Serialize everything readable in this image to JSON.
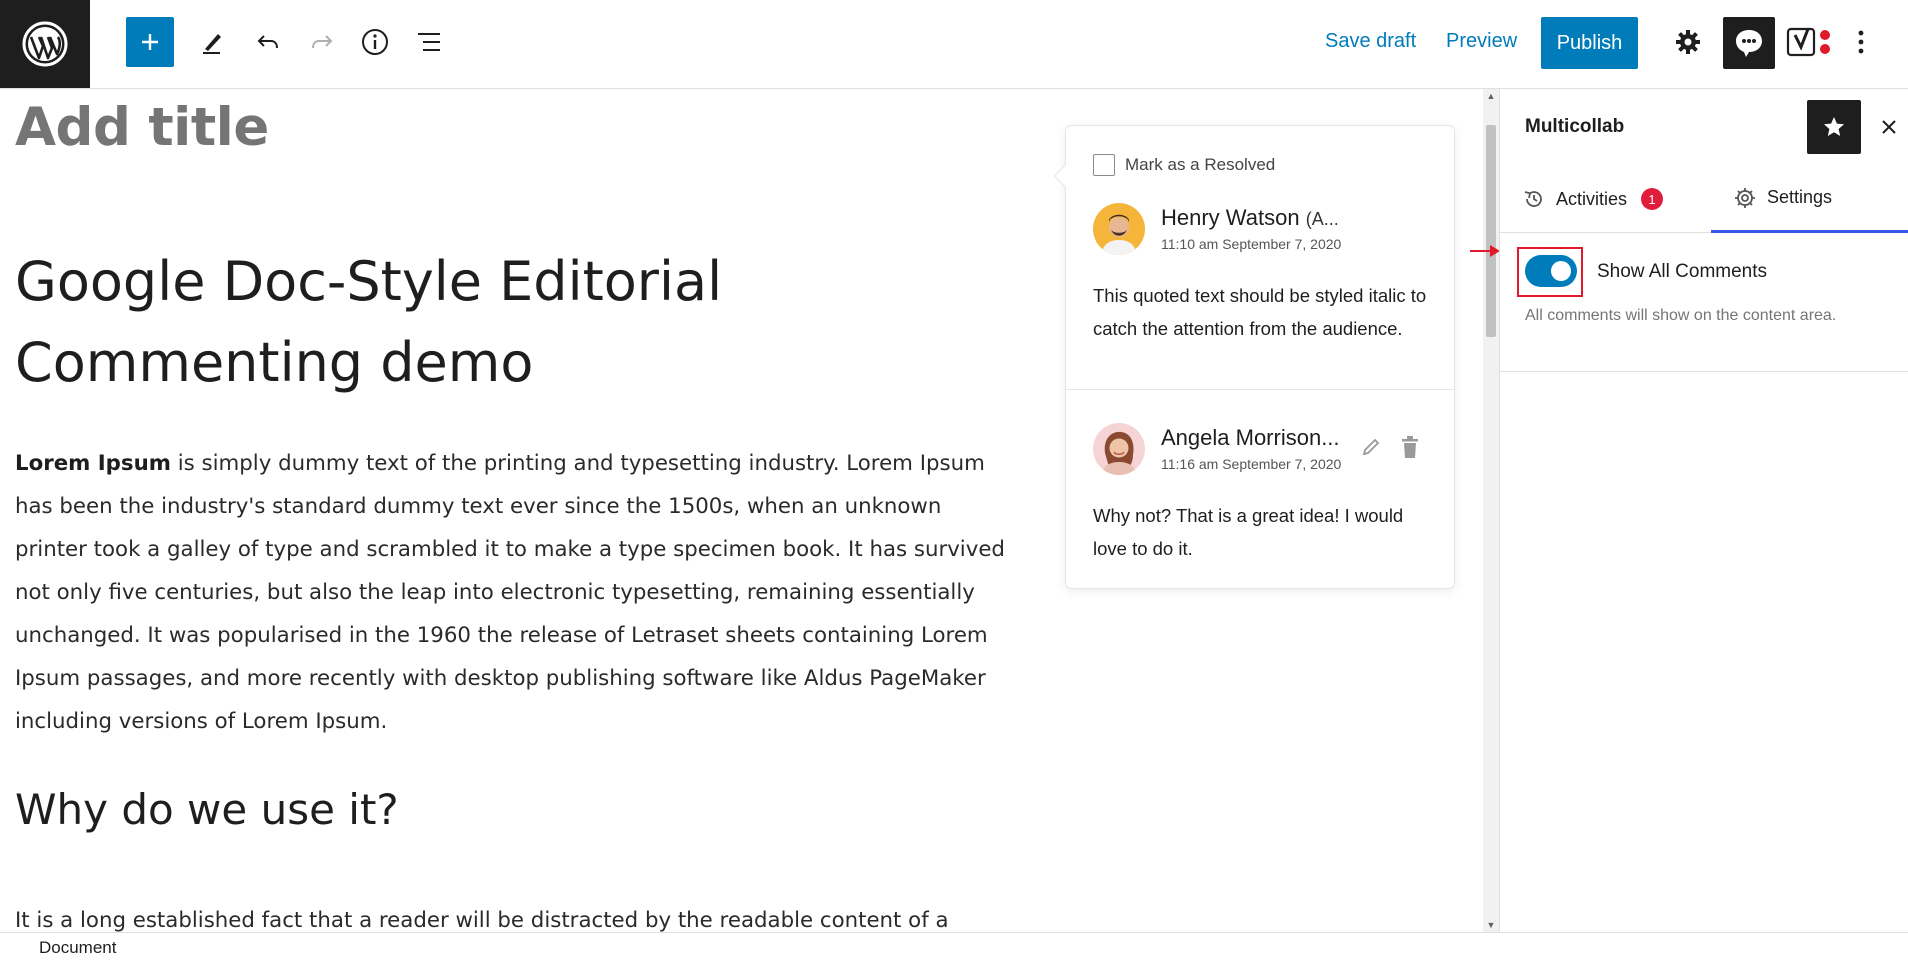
{
  "toolbar": {
    "add_block_icon": "plus-icon",
    "tools_icon": "pencil-icon",
    "undo_icon": "undo-icon",
    "redo_icon": "redo-icon",
    "details_icon": "info-icon",
    "list_view_icon": "list-view-icon",
    "save_draft_label": "Save draft",
    "preview_label": "Preview",
    "publish_label": "Publish",
    "settings_icon": "gear-icon",
    "multicollab_icon": "comment-bubble-icon",
    "yoast_icon": "yoast-icon",
    "more_icon": "kebab-menu-icon"
  },
  "editor": {
    "title_placeholder": "Add title",
    "heading": "Google Doc-Style Editorial Commenting demo",
    "paragraph_bold": "Lorem Ipsum",
    "paragraph_rest": " is simply dummy text of the printing and typesetting industry. Lorem Ipsum has been the industry's standard dummy text ever since the 1500s, when an unknown printer took a galley of type and scrambled it to make a type specimen book. It has survived not only five centuries, but also the leap into electronic typesetting, remaining essentially unchanged. It was popularised in the 1960 the release of Letraset sheets containing Lorem Ipsum passages, and more recently with desktop publishing software like Aldus PageMaker including versions of Lorem Ipsum.",
    "subheading": "Why do we use it?",
    "paragraph2": "It is a long established fact that a reader will be distracted by the readable content of a"
  },
  "comment_board": {
    "resolve_label": "Mark as a Resolved",
    "comments": [
      {
        "name": "Henry Watson",
        "role": "(A...",
        "time": "11:10 am September 7, 2020",
        "text": "This quoted text should be styled italic to catch the attention from the audience."
      },
      {
        "name": "Angela Morrison...",
        "time": "11:16 am September 7, 2020",
        "text": "Why not? That is a great idea! I would love to do it.",
        "edit_icon": "pencil-icon",
        "delete_icon": "trash-icon"
      }
    ]
  },
  "sidebar": {
    "title": "Multicollab",
    "star_icon": "star-icon",
    "close_icon": "close-icon",
    "tabs": [
      {
        "label": "Activities",
        "icon": "history-icon",
        "badge": "1"
      },
      {
        "label": "Settings",
        "icon": "gear-icon"
      }
    ],
    "setting": {
      "label": "Show All Comments",
      "enabled": true,
      "help": "All comments will show on the content area."
    }
  },
  "footer": {
    "breadcrumb": "Document"
  },
  "colors": {
    "accent": "#007cba",
    "dark": "#1e1e1e",
    "badge": "#e01e3c",
    "highlight": "#e0192b",
    "active_tab": "#3858e9"
  }
}
